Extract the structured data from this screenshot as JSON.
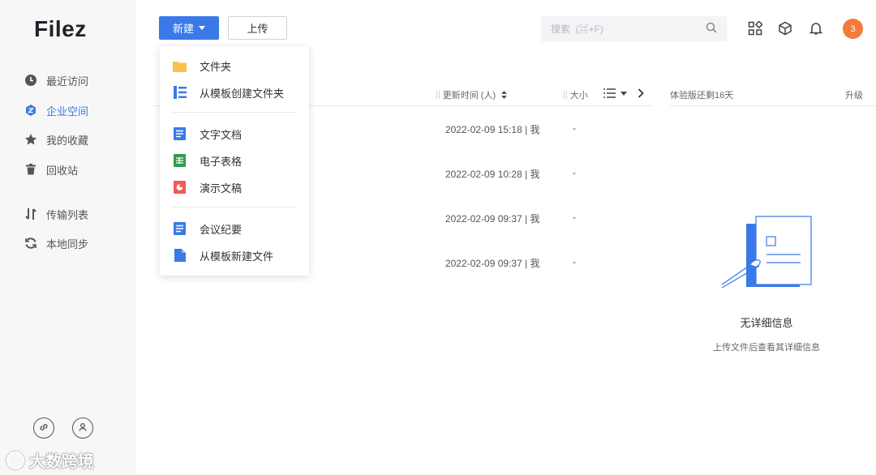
{
  "app": {
    "logo": "Filez"
  },
  "sidebar": {
    "items": [
      {
        "label": "最近访问",
        "icon": "clock-icon"
      },
      {
        "label": "企业空间",
        "icon": "enterprise-icon"
      },
      {
        "label": "我的收藏",
        "icon": "star-icon"
      },
      {
        "label": "回收站",
        "icon": "trash-icon"
      },
      {
        "label": "传输列表",
        "icon": "transfer-icon"
      },
      {
        "label": "本地同步",
        "icon": "sync-icon"
      }
    ],
    "active_index": 1,
    "bottom_icons": [
      "link-icon",
      "share-user-icon"
    ]
  },
  "watermark": {
    "text": "大数跨境"
  },
  "toolbar": {
    "new_label": "新建",
    "upload_label": "上传"
  },
  "search": {
    "placeholder": "搜索  (⌘+F)"
  },
  "notifications": {
    "count": "3"
  },
  "table": {
    "headers": {
      "updated": "更新时间 (人)",
      "size": "大小"
    },
    "rows": [
      {
        "updated": "2022-02-09 15:18 | 我",
        "size": "-"
      },
      {
        "updated": "2022-02-09 10:28 | 我",
        "size": "-"
      },
      {
        "updated": "2022-02-09 09:37 | 我",
        "size": "-"
      },
      {
        "updated": "2022-02-09 09:37 | 我",
        "size": "-"
      }
    ]
  },
  "detail": {
    "trial_text": "体验版还剩16天",
    "upgrade_label": "升级",
    "empty_title": "无详细信息",
    "empty_subtitle": "上传文件后查看其详细信息"
  },
  "dropdown": {
    "groups": [
      [
        {
          "label": "文件夹",
          "icon": "folder-icon"
        },
        {
          "label": "从模板创建文件夹",
          "icon": "template-folder-icon"
        }
      ],
      [
        {
          "label": "文字文档",
          "icon": "doc-icon"
        },
        {
          "label": "电子表格",
          "icon": "sheet-icon"
        },
        {
          "label": "演示文稿",
          "icon": "slides-icon"
        }
      ],
      [
        {
          "label": "会议纪要",
          "icon": "minutes-icon"
        },
        {
          "label": "从模板新建文件",
          "icon": "template-file-icon"
        }
      ]
    ]
  },
  "colors": {
    "accent": "#3b79e8",
    "avatar": "#f47b3a",
    "folder": "#f6c34f",
    "sheet": "#2e9d4e",
    "slides": "#ef5b5b"
  }
}
